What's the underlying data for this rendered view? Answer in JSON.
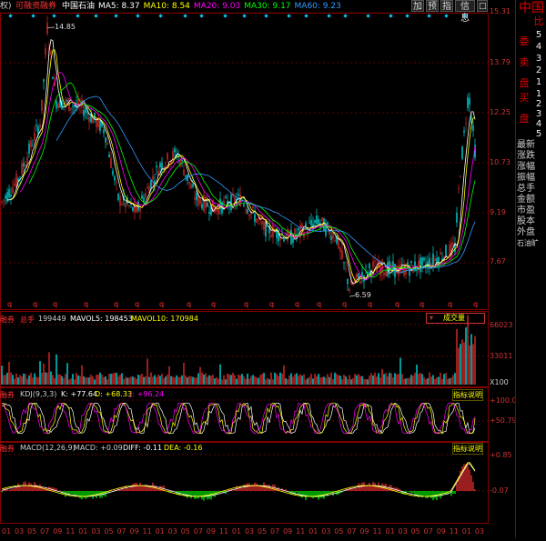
{
  "header": {
    "left_tag": "权)",
    "tag2": "可融资融券",
    "stock_name": "中国石油",
    "ma": [
      {
        "label": "MA5: 8.37",
        "color": "#ffffff"
      },
      {
        "label": "MA10: 8.54",
        "color": "#ffff00"
      },
      {
        "label": "MA20: 9.03",
        "color": "#ff00ff"
      },
      {
        "label": "MA30: 9.17",
        "color": "#00ff00"
      },
      {
        "label": "MA60: 9.23",
        "color": "#3399ff"
      }
    ]
  },
  "toolbar": {
    "buttons": [
      "加",
      "预",
      "指",
      "信息"
    ],
    "collapse": "□"
  },
  "side": {
    "title_big": "中国",
    "sell_chars": [
      "委",
      "卖",
      "盘"
    ],
    "buy_chars": [
      "买",
      "盘"
    ],
    "ratio_char": "比",
    "sell_nums": [
      "5",
      "4",
      "3",
      "2",
      "1"
    ],
    "buy_nums": [
      "1",
      "2",
      "3",
      "4",
      "5"
    ],
    "items": [
      "最新",
      "涨跌",
      "涨幅",
      "振幅",
      "总手",
      "金额",
      "市盈",
      "股本",
      "外盘"
    ],
    "footer": "石油旷"
  },
  "price_axis": [
    "15.31",
    "13.79",
    "12.25",
    "10.73",
    "9.19",
    "7.67"
  ],
  "annotations": {
    "high": "14.85",
    "low": "6.59",
    "q_marker": "q"
  },
  "volume_panel": {
    "tag": "融券",
    "total_label": "总手",
    "total_value": "199449",
    "mavol5": "MAVOL5: 198453",
    "mavol10": "MAVOL10: 170984",
    "dropdown": "成交量",
    "axis": [
      "66023",
      "33011",
      "X100"
    ]
  },
  "kdj_panel": {
    "tag": "融券",
    "name": "KDJ(9,3,3)",
    "k": "K: +77.64",
    "d": "D: +68.33",
    "j": "J: +96.24",
    "help": "指标说明",
    "axis": [
      "+100.00",
      "+50.79"
    ]
  },
  "macd_panel": {
    "tag": "融券",
    "name": "MACD(12,26,9)",
    "macd": "MACD: +0.09",
    "diff": "DIFF: -0.11",
    "dea": "DEA: -0.16",
    "help": "指标说明",
    "axis": [
      "+0.85",
      "-0.07"
    ]
  },
  "x_axis": [
    "01",
    "03",
    "05",
    "07",
    "09",
    "11",
    "01",
    "03",
    "05",
    "07",
    "09",
    "11",
    "01",
    "03",
    "05",
    "07",
    "09",
    "11",
    "01",
    "03",
    "05",
    "07",
    "09",
    "11",
    "01",
    "03",
    "05",
    "07",
    "09",
    "11",
    "01",
    "03",
    "05",
    "07",
    "09",
    "11",
    "01",
    "03"
  ],
  "colors": {
    "up": "#ff3333",
    "down": "#00ffff",
    "grid": "#800000",
    "axis": "#cc3333"
  }
}
